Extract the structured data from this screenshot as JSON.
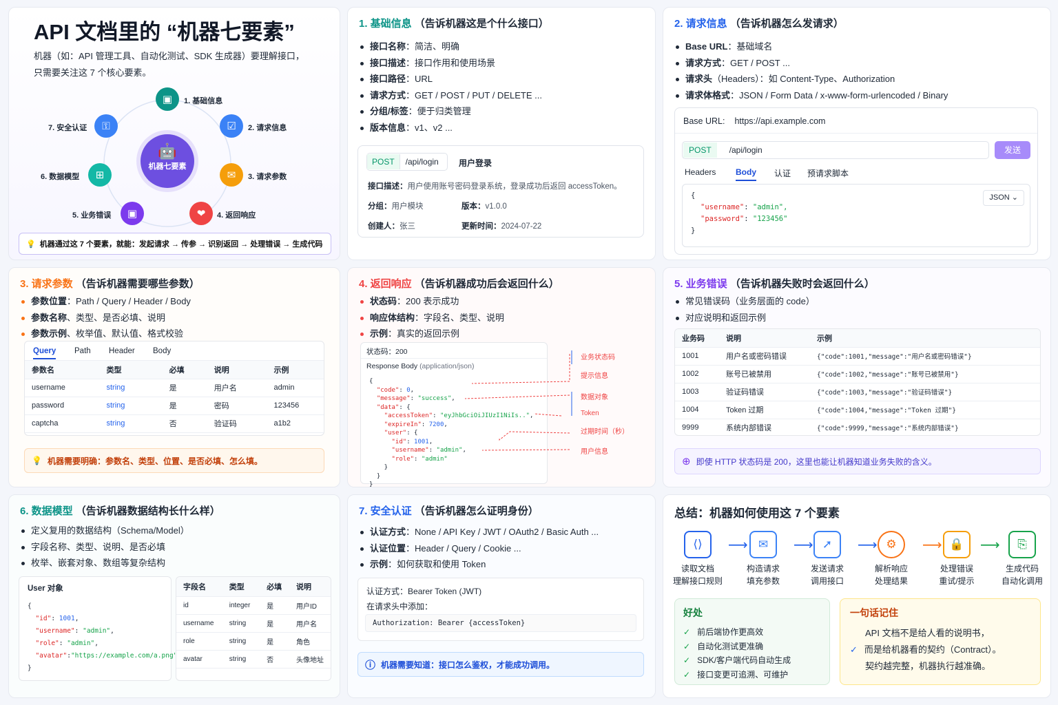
{
  "intro": {
    "title": "API 文档里的 “机器七要素”",
    "desc1": "机器（如：API 管理工具、自动化测试、SDK 生成器）要理解接口，",
    "desc2": "只需要关注这 7 个核心要素。",
    "center": "机器七要素",
    "nodes": [
      "1. 基础信息",
      "2. 请求信息",
      "3. 请求参数",
      "4. 返回响应",
      "5. 业务错误",
      "6. 数据模型",
      "7. 安全认证"
    ],
    "note": "机器通过这 7 个要素，就能：发起请求 → 传参 → 识别返回 → 处理错误 → 生成代码"
  },
  "basic": {
    "num": "1. 基础信息",
    "sub": "（告诉机器这是个什么接口）",
    "items": [
      [
        "接口名称",
        "：简洁、明确"
      ],
      [
        "接口描述",
        "：接口作用和使用场景"
      ],
      [
        "接口路径",
        "：URL"
      ],
      [
        "请求方式",
        "：GET / POST / PUT / DELETE ..."
      ],
      [
        "分组/标签",
        "：便于归类管理"
      ],
      [
        "版本信息",
        "：v1、v2 ..."
      ]
    ],
    "method": "POST",
    "path": "/api/login",
    "name": "用户登录",
    "desc_k": "接口描述：",
    "desc_v": "用户使用账号密码登录系统，登录成功后返回 accessToken。",
    "group_k": "分组：",
    "group_v": "用户模块",
    "ver_k": "版本：",
    "ver_v": "v1.0.0",
    "creator_k": "创建人：",
    "creator_v": "张三",
    "time_k": "更新时间：",
    "time_v": "2024-07-22"
  },
  "request": {
    "num": "2. 请求信息",
    "sub": "（告诉机器怎么发请求）",
    "items": [
      [
        "Base URL",
        "：基础域名"
      ],
      [
        "请求方式",
        "：GET / POST ..."
      ],
      [
        "请求头",
        "（Headers）：如 Content-Type、Authorization"
      ],
      [
        "请求体格式",
        "：JSON / Form Data / x-www-form-urlencoded / Binary"
      ]
    ],
    "base_k": "Base URL:",
    "base_v": "https://api.example.com",
    "method": "POST",
    "path": "/api/login",
    "send": "发送",
    "tabs": [
      "Headers",
      "Body",
      "认证",
      "预请求脚本"
    ],
    "fmt": "JSON",
    "body1": "\"username\"",
    "body1v": "\"admin\",",
    "body2": "\"password\"",
    "body2v": "\"123456\""
  },
  "params": {
    "num": "3. 请求参数",
    "sub": "（告诉机器需要哪些参数）",
    "items": [
      [
        "参数位置",
        "：Path / Query / Header / Body"
      ],
      [
        "参数名称",
        "、类型、是否必填、说明"
      ],
      [
        "参数示例",
        "、枚举值、默认值、格式校验"
      ]
    ],
    "tabs": [
      "Query",
      "Path",
      "Header",
      "Body"
    ],
    "cols": [
      "参数名",
      "类型",
      "必填",
      "说明",
      "示例"
    ],
    "rows": [
      [
        "username",
        "string",
        "是",
        "用户名",
        "admin"
      ],
      [
        "password",
        "string",
        "是",
        "密码",
        "123456"
      ],
      [
        "captcha",
        "string",
        "否",
        "验证码",
        "a1b2"
      ]
    ],
    "note": "机器需要明确：参数名、类型、位置、是否必填、怎么填。"
  },
  "response": {
    "num": "4. 返回响应",
    "sub": "（告诉机器成功后会返回什么）",
    "items": [
      [
        "状态码",
        "：200 表示成功"
      ],
      [
        "响应体结构",
        "：字段名、类型、说明"
      ],
      [
        "示例",
        "：真实的返回示例"
      ]
    ],
    "status_k": "状态码：",
    "status_v": "200",
    "body_title": "Response Body",
    "body_type": "(application/json)",
    "labels": [
      "业务状态码",
      "提示信息",
      "数据对象",
      "Token",
      "过期时间（秒）",
      "用户信息"
    ]
  },
  "errors": {
    "num": "5. 业务错误",
    "sub": "（告诉机器失败时会返回什么）",
    "items": [
      "常见错误码（业务层面的 code）",
      "对应说明和返回示例"
    ],
    "cols": [
      "业务码",
      "说明",
      "示例"
    ],
    "rows": [
      [
        "1001",
        "用户名或密码错误",
        "{\"code\":1001,\"message\":\"用户名或密码错误\"}"
      ],
      [
        "1002",
        "账号已被禁用",
        "{\"code\":1002,\"message\":\"账号已被禁用\"}"
      ],
      [
        "1003",
        "验证码错误",
        "{\"code\":1003,\"message\":\"验证码错误\"}"
      ],
      [
        "1004",
        "Token 过期",
        "{\"code\":1004,\"message\":\"Token 过期\"}"
      ],
      [
        "9999",
        "系统内部错误",
        "{\"code\":9999,\"message\":\"系统内部错误\"}"
      ]
    ],
    "note": "即使 HTTP 状态码是 200，这里也能让机器知道业务失败的含义。"
  },
  "model": {
    "num": "6. 数据模型",
    "sub": "（告诉机器数据结构长什么样）",
    "items": [
      "定义复用的数据结构（Schema/Model）",
      "字段名称、类型、说明、是否必填",
      "枚举、嵌套对象、数组等复杂结构"
    ],
    "obj_title": "User 对象",
    "cols": [
      "字段名",
      "类型",
      "必填",
      "说明"
    ],
    "rows": [
      [
        "id",
        "integer",
        "是",
        "用户ID"
      ],
      [
        "username",
        "string",
        "是",
        "用户名"
      ],
      [
        "role",
        "string",
        "是",
        "角色"
      ],
      [
        "avatar",
        "string",
        "否",
        "头像地址"
      ]
    ]
  },
  "auth": {
    "num": "7. 安全认证",
    "sub": "（告诉机器怎么证明身份）",
    "items": [
      [
        "认证方式",
        "：None / API Key / JWT / OAuth2 / Basic Auth ..."
      ],
      [
        "认证位置",
        "：Header / Query / Cookie ..."
      ],
      [
        "示例",
        "：如何获取和使用 Token"
      ]
    ],
    "mode_k": "认证方式：",
    "mode_v": "Bearer Token (JWT)",
    "hint": "在请求头中添加：",
    "header": "Authorization: Bearer {accessToken}",
    "note": "机器需要知道：接口怎么鉴权，才能成功调用。"
  },
  "summary": {
    "title": "总结：机器如何使用这 7 个要素",
    "flow": [
      [
        "读取文档",
        "理解接口规则"
      ],
      [
        "构造请求",
        "填充参数"
      ],
      [
        "发送请求",
        "调用接口"
      ],
      [
        "解析响应",
        "处理结果"
      ],
      [
        "处理错误",
        "重试/提示"
      ],
      [
        "生成代码",
        "自动化调用"
      ]
    ],
    "benefit_title": "好处",
    "benefits": [
      "前后端协作更高效",
      "自动化测试更准确",
      "SDK/客户端代码自动生成",
      "接口变更可追溯、可维护"
    ],
    "remember_title": "一句话记住",
    "remember": [
      "API 文档不是给人看的说明书，",
      "而是给机器看的契约（Contract）。",
      "契约越完整，机器执行越准确。"
    ]
  },
  "colors": {
    "blue": "#2563eb",
    "teal": "#0d9488",
    "orange": "#f97316",
    "red": "#ef4444",
    "purple": "#7c3aed"
  }
}
